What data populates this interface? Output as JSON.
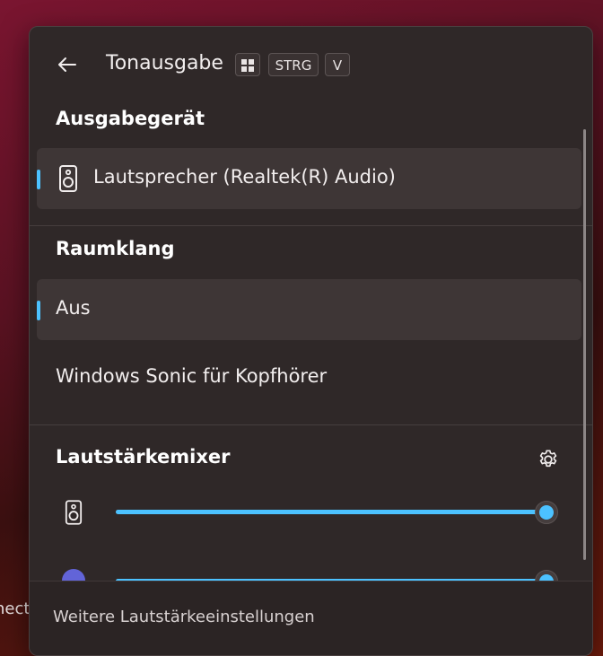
{
  "desktop": {
    "peek_text": "nect"
  },
  "header": {
    "title": "Tonausgabe",
    "shortcut_keys": [
      "STRG",
      "V"
    ]
  },
  "output_device": {
    "section_title": "Ausgabegerät",
    "items": [
      {
        "label": "Lautsprecher (Realtek(R) Audio)",
        "icon": "speaker-icon",
        "selected": true
      }
    ]
  },
  "spatial_sound": {
    "section_title": "Raumklang",
    "items": [
      {
        "label": "Aus",
        "selected": true
      },
      {
        "label": "Windows Sonic für Kopfhörer",
        "selected": false
      }
    ]
  },
  "volume_mixer": {
    "section_title": "Lautstärkemixer",
    "settings_icon": "gear-icon",
    "rows": [
      {
        "icon": "speaker-icon",
        "volume": 100
      },
      {
        "icon": "app-icon",
        "volume": 100
      }
    ]
  },
  "footer": {
    "link": "Weitere Lautstärkeeinstellungen"
  },
  "colors": {
    "accent": "#4cc2ff",
    "panel": "#2f2828"
  }
}
